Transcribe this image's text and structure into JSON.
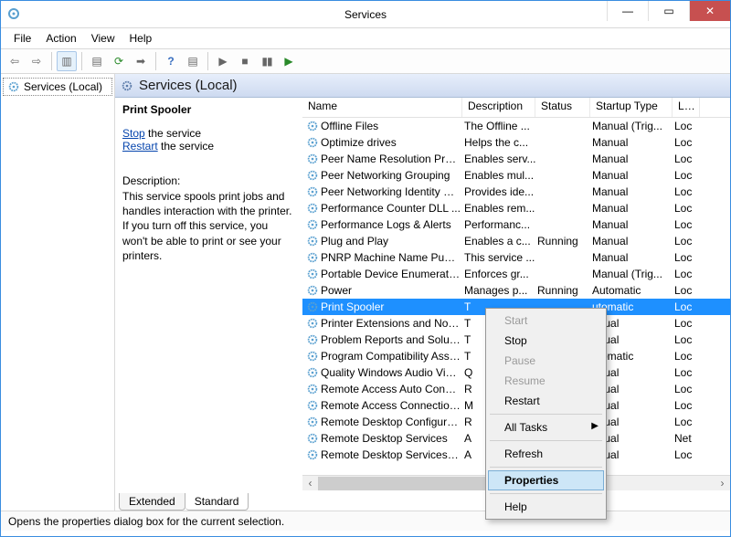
{
  "window": {
    "title": "Services"
  },
  "menus": {
    "file": "File",
    "action": "Action",
    "view": "View",
    "help": "Help"
  },
  "tree": {
    "root": "Services (Local)"
  },
  "header": {
    "label": "Services (Local)"
  },
  "detail": {
    "service_name": "Print Spooler",
    "stop_word": "Stop",
    "stop_rest": " the service",
    "restart_word": "Restart",
    "restart_rest": " the service",
    "desc_label": "Description:",
    "desc_text": "This service spools print jobs and handles interaction with the printer. If you turn off this service, you won't be able to print or see your printers."
  },
  "columns": {
    "name": "Name",
    "desc": "Description",
    "status": "Status",
    "startup": "Startup Type",
    "logon": "Log"
  },
  "rows": [
    {
      "name": "Offline Files",
      "desc": "The Offline ...",
      "status": "",
      "startup": "Manual (Trig...",
      "logon": "Loc"
    },
    {
      "name": "Optimize drives",
      "desc": "Helps the c...",
      "status": "",
      "startup": "Manual",
      "logon": "Loc"
    },
    {
      "name": "Peer Name Resolution Prot...",
      "desc": "Enables serv...",
      "status": "",
      "startup": "Manual",
      "logon": "Loc"
    },
    {
      "name": "Peer Networking Grouping",
      "desc": "Enables mul...",
      "status": "",
      "startup": "Manual",
      "logon": "Loc"
    },
    {
      "name": "Peer Networking Identity M...",
      "desc": "Provides ide...",
      "status": "",
      "startup": "Manual",
      "logon": "Loc"
    },
    {
      "name": "Performance Counter DLL ...",
      "desc": "Enables rem...",
      "status": "",
      "startup": "Manual",
      "logon": "Loc"
    },
    {
      "name": "Performance Logs & Alerts",
      "desc": "Performanc...",
      "status": "",
      "startup": "Manual",
      "logon": "Loc"
    },
    {
      "name": "Plug and Play",
      "desc": "Enables a c...",
      "status": "Running",
      "startup": "Manual",
      "logon": "Loc"
    },
    {
      "name": "PNRP Machine Name Publi...",
      "desc": "This service ...",
      "status": "",
      "startup": "Manual",
      "logon": "Loc"
    },
    {
      "name": "Portable Device Enumerator...",
      "desc": "Enforces gr...",
      "status": "",
      "startup": "Manual (Trig...",
      "logon": "Loc"
    },
    {
      "name": "Power",
      "desc": "Manages p...",
      "status": "Running",
      "startup": "Automatic",
      "logon": "Loc"
    },
    {
      "name": "Print Spooler",
      "desc": "T",
      "status": "",
      "startup": "utomatic",
      "logon": "Loc",
      "selected": true
    },
    {
      "name": "Printer Extensions and Notif...",
      "desc": "T",
      "status": "",
      "startup": "anual",
      "logon": "Loc"
    },
    {
      "name": "Problem Reports and Soluti...",
      "desc": "T",
      "status": "",
      "startup": "anual",
      "logon": "Loc"
    },
    {
      "name": "Program Compatibility Assi...",
      "desc": "T",
      "status": "",
      "startup": "utomatic",
      "logon": "Loc"
    },
    {
      "name": "Quality Windows Audio Vid...",
      "desc": "Q",
      "status": "",
      "startup": "anual",
      "logon": "Loc"
    },
    {
      "name": "Remote Access Auto Conne...",
      "desc": "R",
      "status": "",
      "startup": "anual",
      "logon": "Loc"
    },
    {
      "name": "Remote Access Connection...",
      "desc": "M",
      "status": "",
      "startup": "anual",
      "logon": "Loc"
    },
    {
      "name": "Remote Desktop Configurat...",
      "desc": "R",
      "status": "",
      "startup": "anual",
      "logon": "Loc"
    },
    {
      "name": "Remote Desktop Services",
      "desc": "A",
      "status": "",
      "startup": "anual",
      "logon": "Net"
    },
    {
      "name": "Remote Desktop Services U...",
      "desc": "A",
      "status": "",
      "startup": "anual",
      "logon": "Loc"
    }
  ],
  "context_menu": {
    "start": "Start",
    "stop": "Stop",
    "pause": "Pause",
    "resume": "Resume",
    "restart": "Restart",
    "all_tasks": "All Tasks",
    "refresh": "Refresh",
    "properties": "Properties",
    "help": "Help"
  },
  "tabs": {
    "extended": "Extended",
    "standard": "Standard"
  },
  "statusbar": {
    "text": "Opens the properties dialog box for the current selection."
  }
}
